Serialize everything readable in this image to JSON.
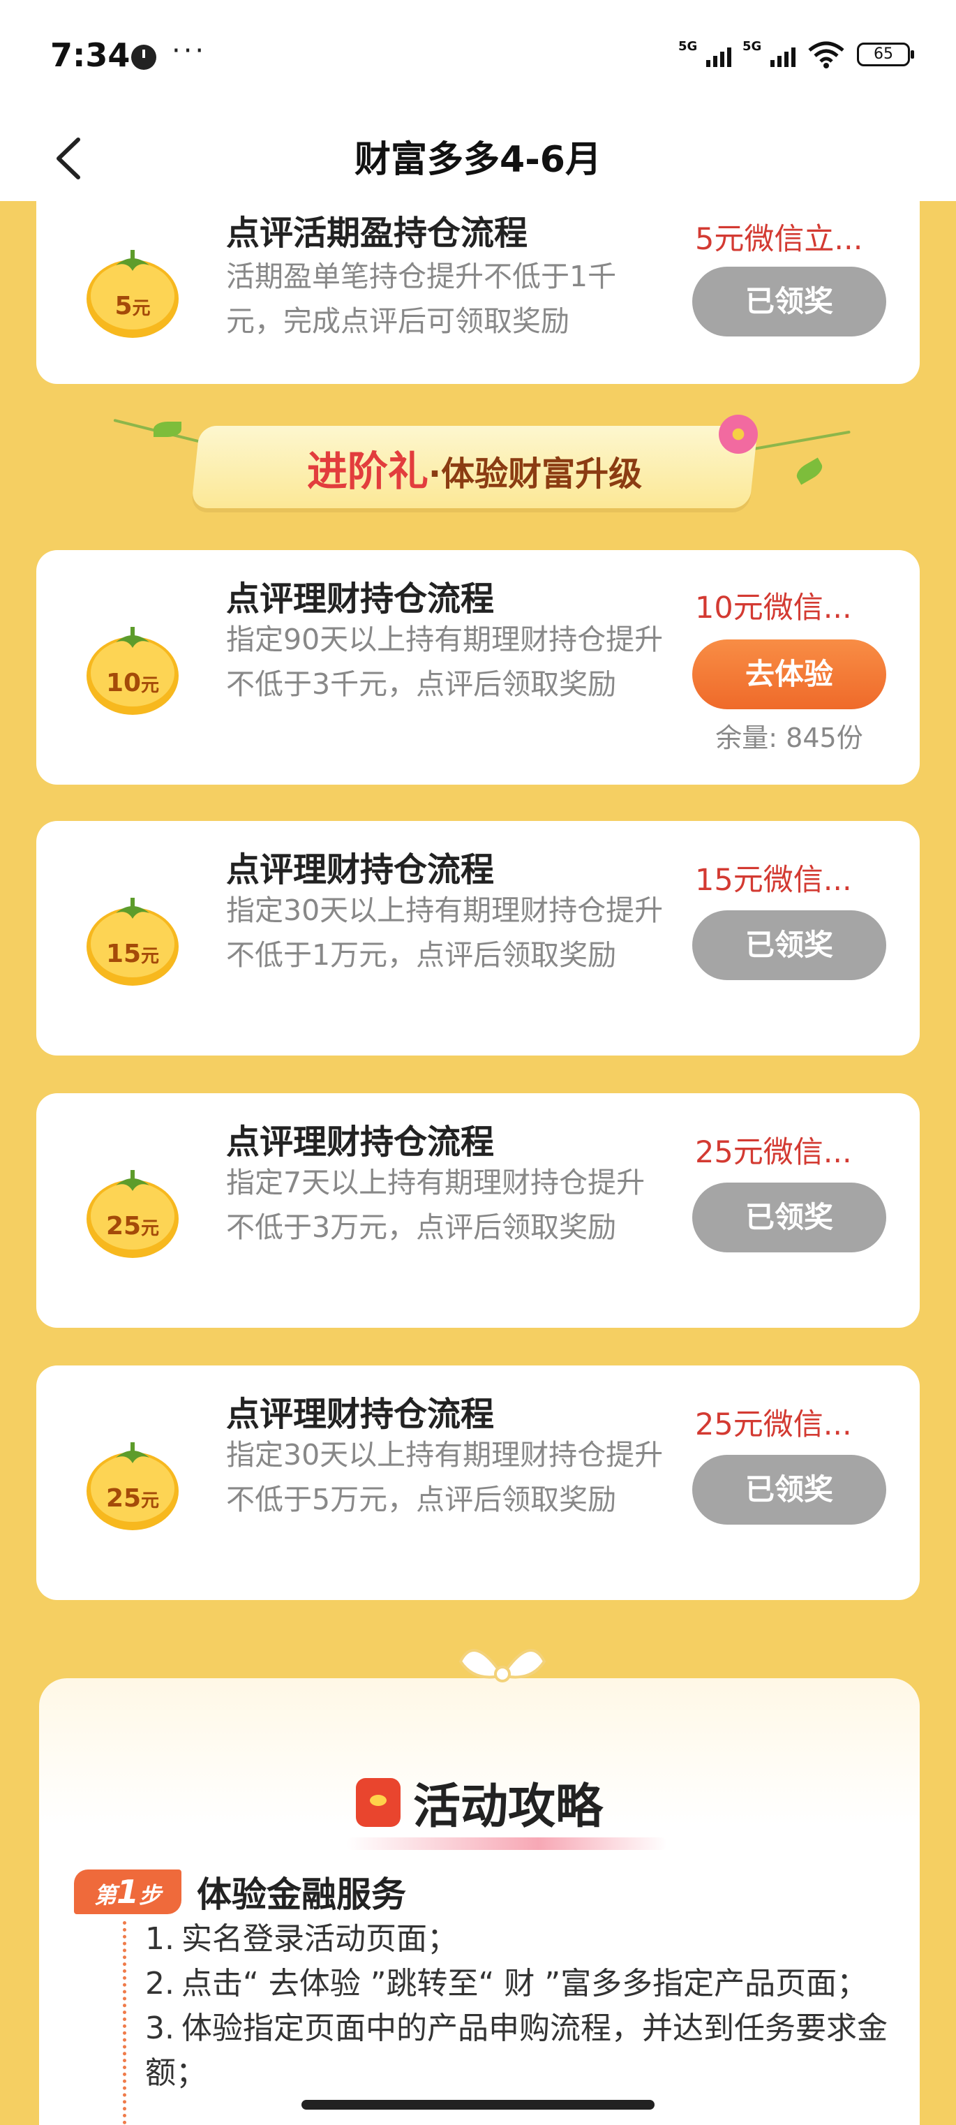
{
  "status_bar": {
    "time": "7:34",
    "more": "···",
    "signal1": "5G",
    "signal2": "5G",
    "battery": "65"
  },
  "nav": {
    "title": "财富多多4-6月"
  },
  "top_task": {
    "title": "点评活期盈持仓流程",
    "desc": "活期盈单笔持仓提升不低于1千元，完成点评后可领取奖励",
    "coin": "5",
    "coin_unit": "元",
    "reward": "5元微信立...",
    "button": "已领奖"
  },
  "banner": {
    "main": "进阶礼",
    "sep": "·",
    "sub": "体验财富升级"
  },
  "tasks": [
    {
      "title": "点评理财持仓流程",
      "desc": "指定90天以上持有期理财持仓提升不低于3千元，点评后领取奖励",
      "coin": "10",
      "coin_unit": "元",
      "reward": "10元微信...",
      "button": "去体验",
      "remain": "余量: 845份"
    },
    {
      "title": "点评理财持仓流程",
      "desc": "指定30天以上持有期理财持仓提升不低于1万元，点评后领取奖励",
      "coin": "15",
      "coin_unit": "元",
      "reward": "15元微信...",
      "button": "已领奖"
    },
    {
      "title": "点评理财持仓流程",
      "desc": "指定7天以上持有期理财持仓提升不低于3万元，点评后领取奖励",
      "coin": "25",
      "coin_unit": "元",
      "reward": "25元微信...",
      "button": "已领奖"
    },
    {
      "title": "点评理财持仓流程",
      "desc": "指定30天以上持有期理财持仓提升不低于5万元，点评后领取奖励",
      "coin": "25",
      "coin_unit": "元",
      "reward": "25元微信...",
      "button": "已领奖"
    }
  ],
  "guide": {
    "title": "活动攻略",
    "step_prefix": "第",
    "step_num": "1",
    "step_suffix": "步",
    "step_title": "体验金融服务",
    "items": [
      {
        "num": "1.",
        "text": "实名登录活动页面；"
      },
      {
        "num": "2.",
        "text": "点击“ 去体验 ”跳转至“ 财 ”富多多指定产品页面；"
      },
      {
        "num": "3.",
        "text": "体验指定页面中的产品申购流程，并达到任务要求金额；"
      }
    ]
  },
  "colors": {
    "background": "#f5cf62",
    "reward_red": "#d33a32",
    "go_button": "#ef6a2a",
    "done_button": "#a5a5a5"
  },
  "icons": [
    "back-arrow-icon",
    "clock-icon",
    "signal-icon",
    "wifi-icon",
    "battery-icon",
    "persimmon-coin-icon",
    "red-envelope-icon",
    "bow-icon"
  ]
}
